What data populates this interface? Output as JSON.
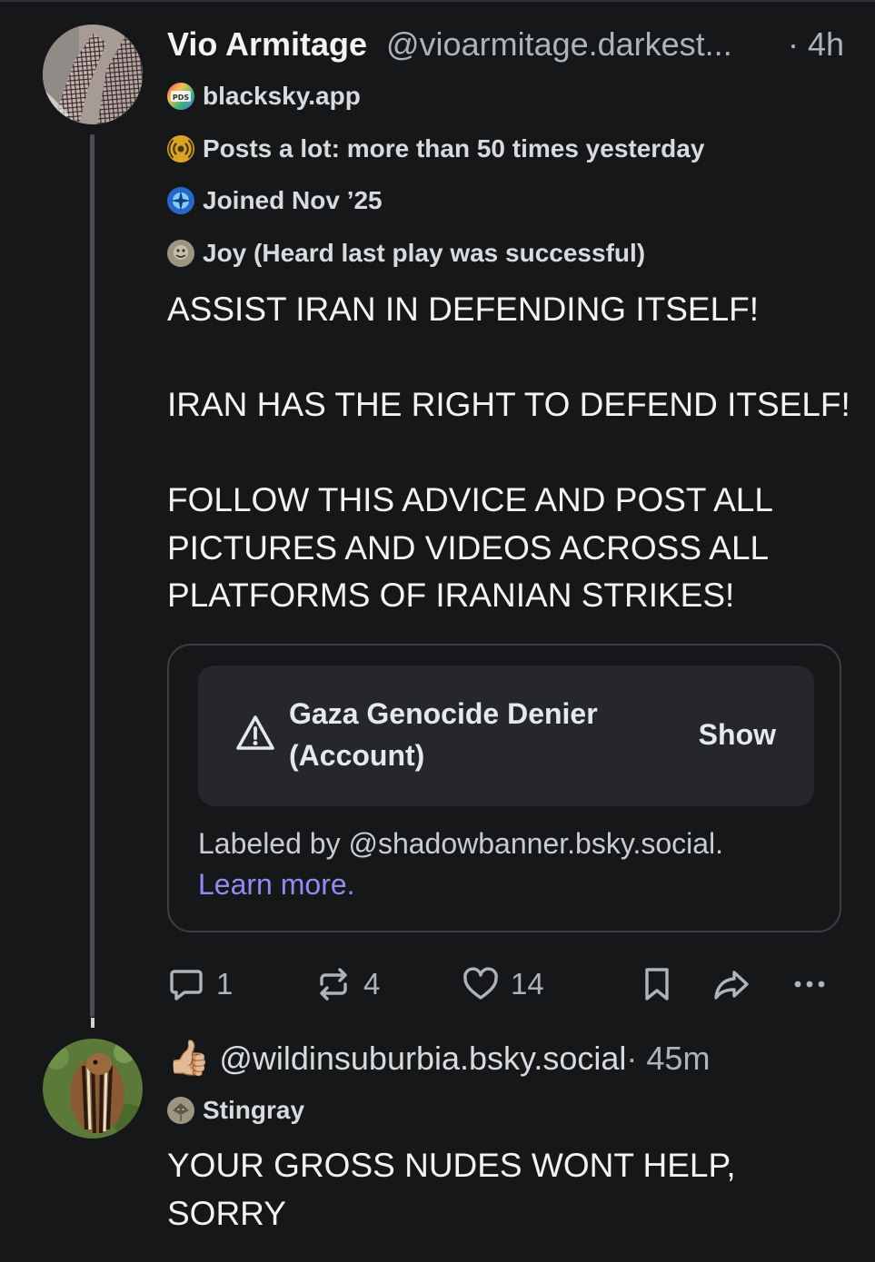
{
  "post": {
    "author_name": "Vio Armitage",
    "author_handle": "@vioarmitage.darkest...",
    "time": "· 4h",
    "badges": [
      {
        "icon": "pds-icon",
        "text": "blacksky.app"
      },
      {
        "icon": "broadcast-icon",
        "text": "Posts a lot: more than 50 times yesterday"
      },
      {
        "icon": "new-user-icon",
        "text": "Joined Nov ’25"
      },
      {
        "icon": "joy-icon",
        "text": "Joy (Heard last play was successful)"
      }
    ],
    "paragraphs": [
      "ASSIST IRAN IN DEFENDING ITSELF!",
      "IRAN HAS THE RIGHT TO DEFEND ITSELF!",
      "FOLLOW THIS ADVICE AND POST ALL\nPICTURES AND VIDEOS ACROSS ALL\nPLATFORMS OF IRANIAN STRIKES!"
    ],
    "label": {
      "title": "Gaza Genocide Denier\n(Account)",
      "show": "Show",
      "labeled_by": "Labeled by @shadowbanner.bsky.social.",
      "learn_more": "Learn more."
    },
    "actions": {
      "replies": "1",
      "reposts": "4",
      "likes": "14"
    }
  },
  "reply": {
    "emoji": "👍🏼",
    "handle": "@wildinsuburbia.bsky.social",
    "time": " · 45m",
    "badge": {
      "icon": "stingray-icon",
      "text": "Stingray"
    },
    "text": "YOUR GROSS NUDES WONT HELP,\nSORRY"
  },
  "colors": {
    "background": "#161718",
    "text": "#f1f3f5",
    "muted": "#aeb4ba",
    "link": "#8f8cf4",
    "card_border": "#3b3f44",
    "label_bg": "#25272c"
  }
}
